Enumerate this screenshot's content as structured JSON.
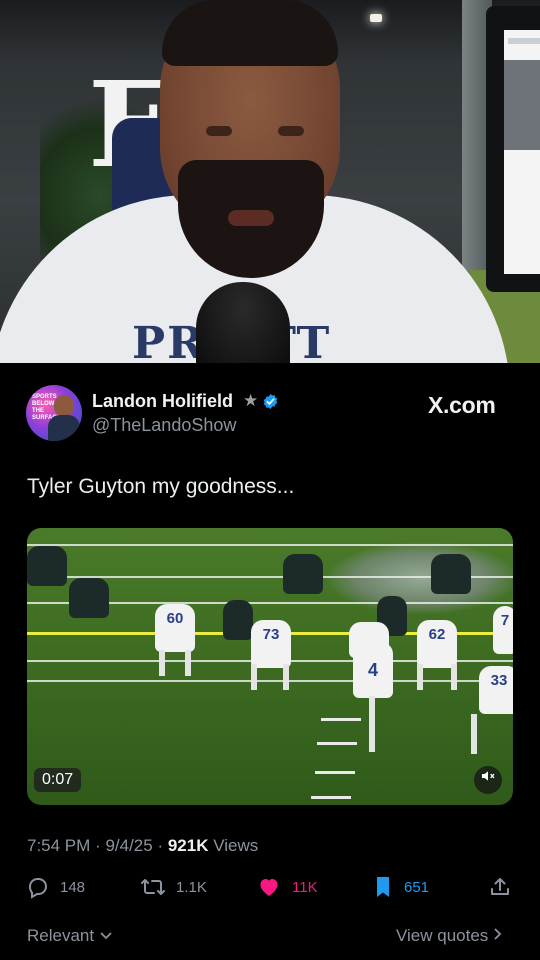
{
  "webcam": {
    "wall_text": "EL",
    "shirt_text": "PR    OTT"
  },
  "tweet": {
    "author_name": "Landon Holifield",
    "author_handle": "@TheLandoShow",
    "avatar_text": "SPORTS BELOW THE SURFACE",
    "source": "X.com",
    "text": "Tyler Guyton my goodness...",
    "video": {
      "duration": "0:07",
      "jersey_numbers": [
        "60",
        "73",
        "4",
        "62",
        "33",
        "7"
      ]
    },
    "time": "7:54 PM",
    "date": "9/4/25",
    "views_count": "921K",
    "views_label": "Views",
    "replies": "148",
    "reposts": "1.1K",
    "likes": "11K",
    "bookmarks": "651"
  },
  "footer": {
    "sort_label": "Relevant",
    "view_quotes": "View quotes"
  },
  "colors": {
    "like": "#f91880",
    "bookmark": "#1d9bf0",
    "verified": "#1d9bf0",
    "background": "#000000"
  }
}
